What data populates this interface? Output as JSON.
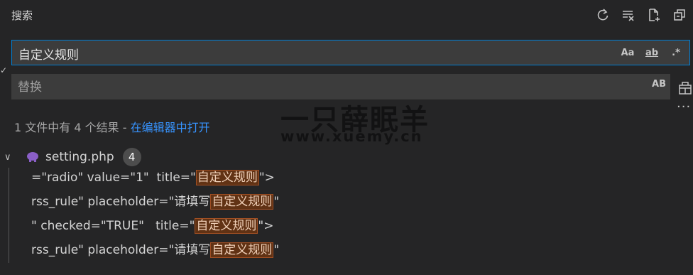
{
  "panel": {
    "title": "搜索",
    "actions": [
      "refresh-icon",
      "clear-results-icon",
      "new-search-editor-icon",
      "collapse-all-icon"
    ]
  },
  "search": {
    "value": "自定义规则",
    "options": {
      "match_case": "Aa",
      "whole_word": "ab",
      "regex": ".*"
    }
  },
  "replace": {
    "placeholder": "替换",
    "preserve_case": "AB"
  },
  "summary": {
    "text": "1 文件中有 4 个结果 - ",
    "link": "在编辑器中打开"
  },
  "watermark": {
    "line1": "一只薛眠羊",
    "line2": "www.xuemy.cn"
  },
  "file": {
    "name": "setting.php",
    "count": "4",
    "icon": "php-elephant-icon",
    "icon_color": "#8a5fc7"
  },
  "matches": [
    {
      "before": "=\"radio\" value=\"1\"  title=\"",
      "match": "自定义规则",
      "after": "\">"
    },
    {
      "before": "rss_rule\" placeholder=\"请填写",
      "match": "自定义规则",
      "after": "\""
    },
    {
      "before": "\" checked=\"TRUE\"   title=\"",
      "match": "自定义规则",
      "after": "\">"
    },
    {
      "before": "rss_rule\" placeholder=\"请填写",
      "match": "自定义规则",
      "after": "\""
    }
  ],
  "colors": {
    "background": "#252526",
    "input_bg": "#3c3c3c",
    "focus_border": "#007fd4",
    "link": "#3794ff",
    "highlight_bg": "#613214"
  }
}
